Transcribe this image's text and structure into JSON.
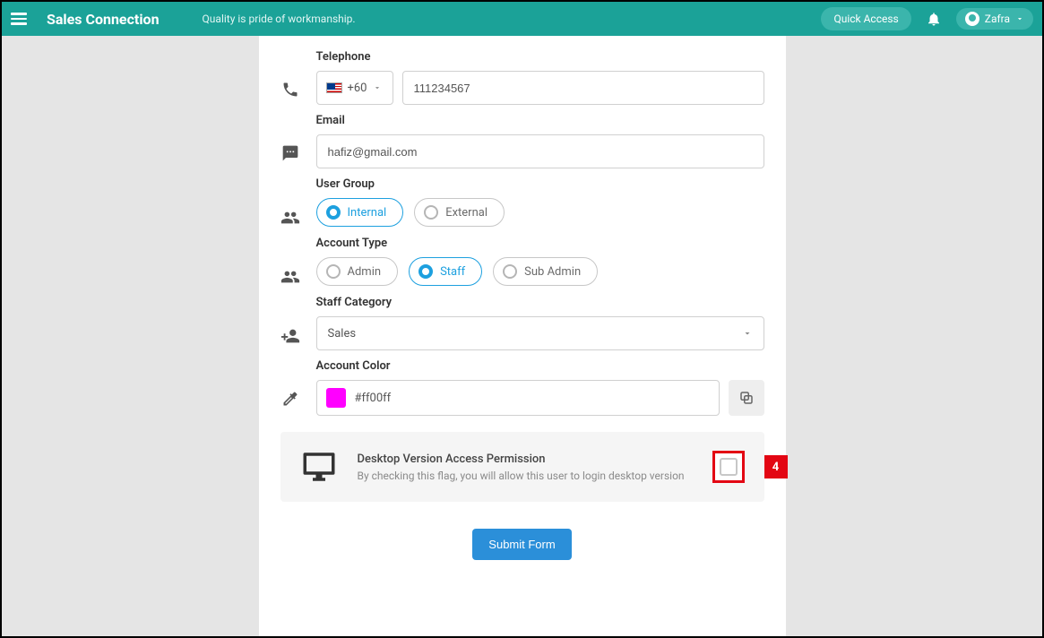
{
  "header": {
    "app_title": "Sales Connection",
    "tagline": "Quality is pride of workmanship.",
    "quick_access": "Quick Access",
    "user_name": "Zafra"
  },
  "form": {
    "telephone": {
      "label": "Telephone",
      "country_code": "+60",
      "value": "111234567"
    },
    "email": {
      "label": "Email",
      "value": "hafiz@gmail.com"
    },
    "user_group": {
      "label": "User Group",
      "options": [
        "Internal",
        "External"
      ],
      "selected": "Internal"
    },
    "account_type": {
      "label": "Account Type",
      "options": [
        "Admin",
        "Staff",
        "Sub Admin"
      ],
      "selected": "Staff"
    },
    "staff_category": {
      "label": "Staff Category",
      "value": "Sales"
    },
    "account_color": {
      "label": "Account Color",
      "swatch": "#ff00ff",
      "value": "#ff00ff"
    },
    "desktop_permission": {
      "title": "Desktop Version Access Permission",
      "desc": "By checking this flag, you will allow this user to login desktop version",
      "badge": "4"
    },
    "submit_label": "Submit Form"
  }
}
